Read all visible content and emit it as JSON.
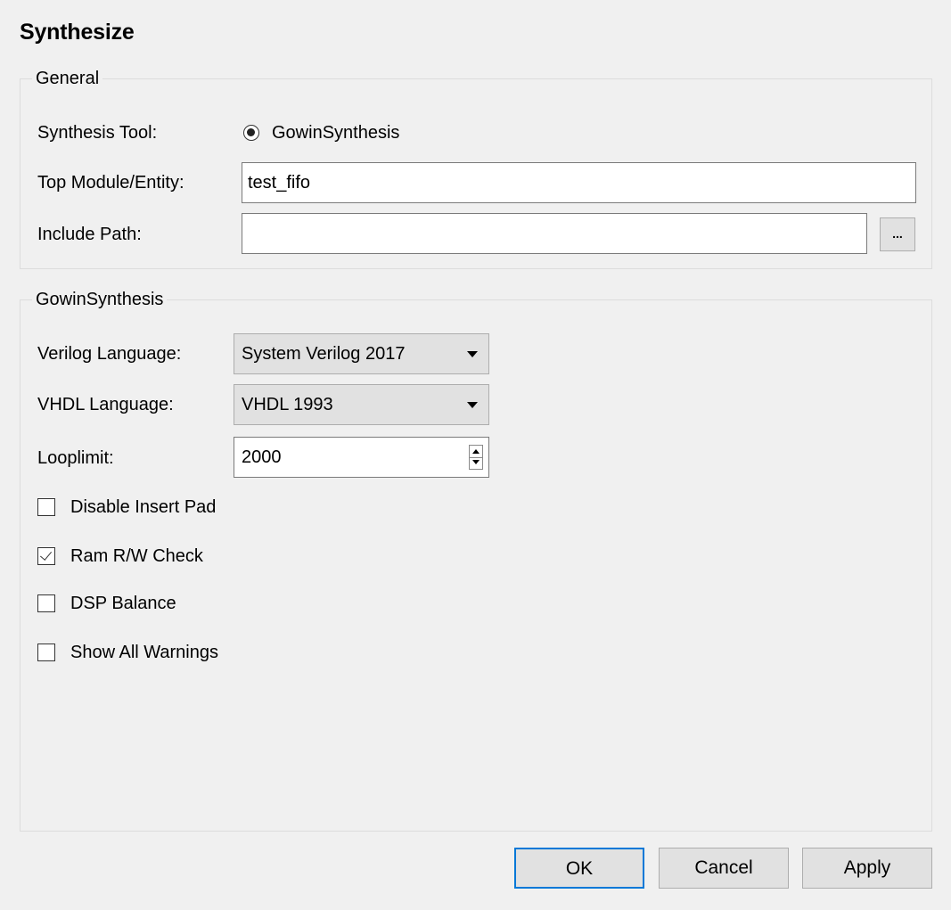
{
  "title": "Synthesize",
  "general": {
    "legend": "General",
    "synthesis_tool_label": "Synthesis Tool:",
    "synthesis_tool_option": "GowinSynthesis",
    "top_module_label": "Top Module/Entity:",
    "top_module_value": "test_fifo",
    "include_path_label": "Include Path:",
    "include_path_value": "",
    "browse_label": "..."
  },
  "gowin": {
    "legend": "GowinSynthesis",
    "verilog_label": "Verilog Language:",
    "verilog_value": "System Verilog 2017",
    "vhdl_label": "VHDL Language:",
    "vhdl_value": "VHDL 1993",
    "looplimit_label": "Looplimit:",
    "looplimit_value": "2000",
    "options": [
      {
        "label": "Disable Insert Pad",
        "checked": false
      },
      {
        "label": "Ram R/W Check",
        "checked": true
      },
      {
        "label": "DSP Balance",
        "checked": false
      },
      {
        "label": "Show All Warnings",
        "checked": false
      }
    ]
  },
  "buttons": {
    "ok": "OK",
    "cancel": "Cancel",
    "apply": "Apply"
  },
  "colors": {
    "default_button_border": "#0078d7",
    "background": "#f0f0f0"
  }
}
